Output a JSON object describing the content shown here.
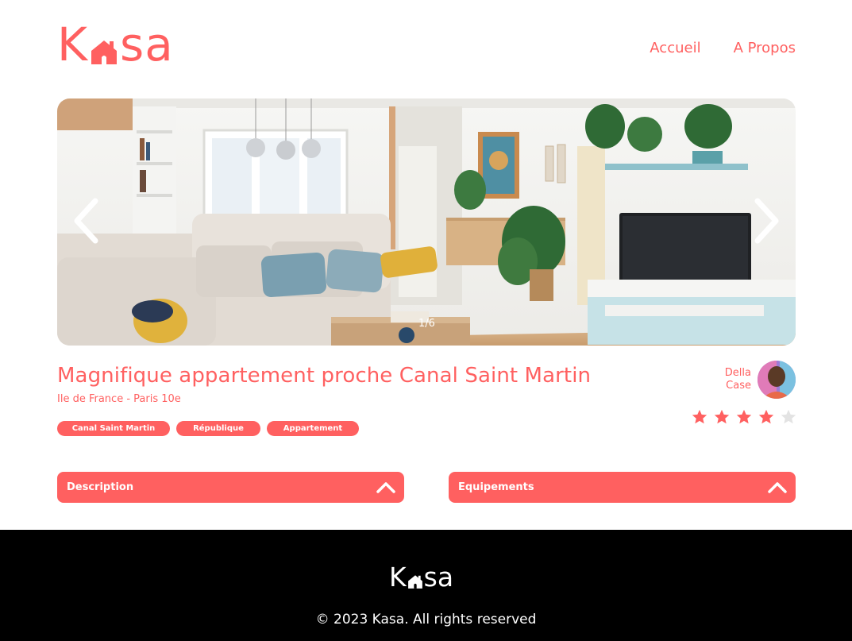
{
  "header": {
    "logo_text": "Kasa",
    "logo_letters": [
      "K",
      "s",
      "a"
    ],
    "nav": [
      {
        "label": "Accueil"
      },
      {
        "label": "A Propos"
      }
    ]
  },
  "gallery": {
    "counter": "1/6",
    "current": 1,
    "total": 6,
    "prev_icon": "chevron-left-icon",
    "next_icon": "chevron-right-icon"
  },
  "listing": {
    "title": "Magnifique appartement proche Canal Saint Martin",
    "location": "Ile de France - Paris 10e",
    "tags": [
      "Canal Saint Martin",
      "République",
      "Appartement"
    ],
    "host": {
      "first_name": "Della",
      "last_name": "Case"
    },
    "rating": 4,
    "rating_max": 5
  },
  "collapses": [
    {
      "label": "Description",
      "icon": "chevron-up-icon"
    },
    {
      "label": "Equipements",
      "icon": "chevron-up-icon"
    }
  ],
  "footer": {
    "logo_text": "Kasa",
    "copyright": "© 2023 Kasa. All rights reserved"
  },
  "colors": {
    "accent": "#FF6060",
    "footer_bg": "#000000",
    "star_empty": "#E3E3E3"
  }
}
